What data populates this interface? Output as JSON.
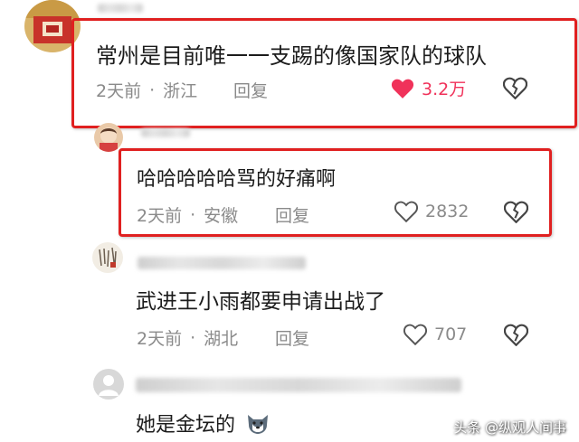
{
  "comments": [
    {
      "text": "常州是目前唯一一支踢的像国家队的球队",
      "time": "2天前",
      "separator": "·",
      "location": "浙江",
      "reply_label": "回复",
      "likes": "3.2万",
      "liked": true,
      "highlighted": true
    },
    {
      "text": "哈哈哈哈哈骂的好痛啊",
      "time": "2天前",
      "separator": "·",
      "location": "安徽",
      "reply_label": "回复",
      "likes": "2832",
      "liked": false,
      "highlighted": true
    },
    {
      "text": "武进王小雨都要申请出战了",
      "time": "2天前",
      "separator": "·",
      "location": "湖北",
      "reply_label": "回复",
      "likes": "707",
      "liked": false,
      "highlighted": false
    },
    {
      "text": "她是金坛的",
      "emoji": "husky-emoji",
      "highlighted": false
    }
  ],
  "colors": {
    "highlight_box": "#e02020",
    "liked_heart": "#f0325a",
    "meta_text": "#8a8a8a"
  },
  "watermark": "头条 @纵观人间事"
}
